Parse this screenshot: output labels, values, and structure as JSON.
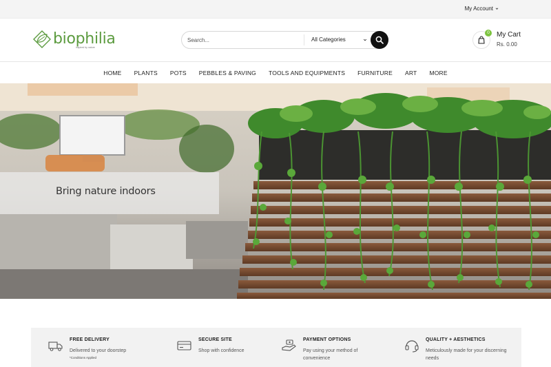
{
  "topbar": {
    "account_label": "My Account"
  },
  "header": {
    "logo_text": "biophilia",
    "logo_tagline": "inspired by nature",
    "search_placeholder": "Search...",
    "category_selected": "All Categories",
    "cart_title": "My Cart",
    "cart_total": "Rs. 0.00",
    "cart_count": "0"
  },
  "nav": {
    "items": [
      "HOME",
      "PLANTS",
      "POTS",
      "PEBBLES & PAVING",
      "TOOLS AND EQUIPMENTS",
      "FURNITURE",
      "ART",
      "MORE"
    ]
  },
  "hero": {
    "headline": "Bring nature indoors"
  },
  "features": [
    {
      "icon": "delivery-truck-icon",
      "title": "FREE DELIVERY",
      "desc": "Delivered to your doorstep",
      "note": "*Conditions Applied"
    },
    {
      "icon": "credit-card-icon",
      "title": "SECURE SITE",
      "desc": "Shop with confidence",
      "note": ""
    },
    {
      "icon": "payment-hand-icon",
      "title": "PAYMENT OPTIONS",
      "desc": "Pay using your method of convenience",
      "note": ""
    },
    {
      "icon": "headset-icon",
      "title": "QUALITY + AESTHETICS",
      "desc": "Meticulously made for your discerning needs",
      "note": ""
    }
  ],
  "colors": {
    "brand_green": "#5c9b3f",
    "badge_green": "#7cc33f",
    "search_button": "#111111"
  }
}
